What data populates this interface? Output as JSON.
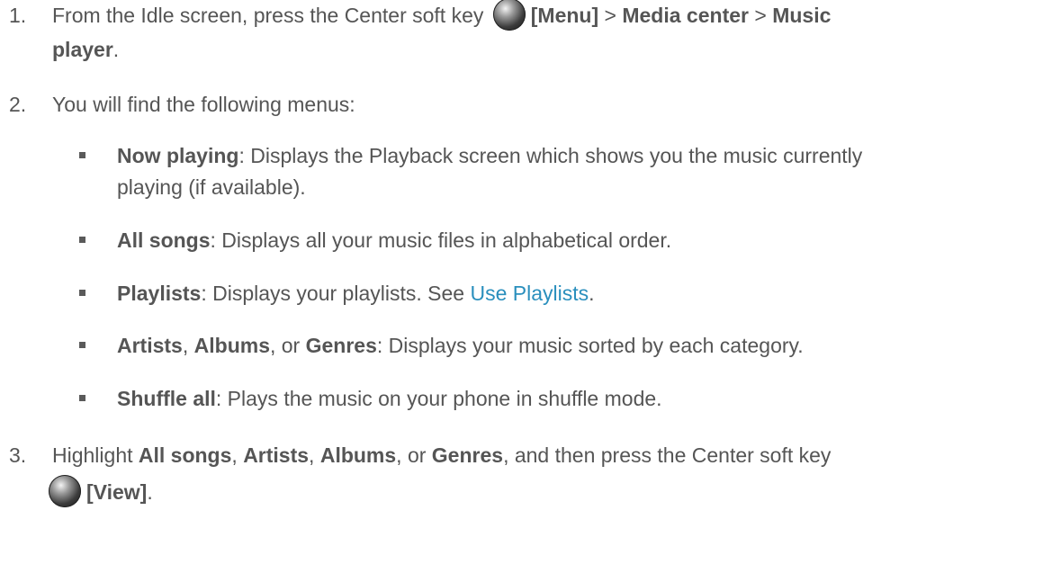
{
  "step1": {
    "number": "1.",
    "prefix": "From the Idle screen, press the Center soft key",
    "key_label": "[Menu]",
    "sep1": ">",
    "media_center": "Media center",
    "sep2": ">",
    "music": "Music",
    "player": "player",
    "end": "."
  },
  "step2": {
    "number": "2.",
    "text": "You will find the following menus:"
  },
  "bullets": {
    "now_playing": {
      "term": "Now playing",
      "desc_line1": ": Displays the Playback screen which shows you the music currently",
      "desc_line2": "playing (if available)."
    },
    "all_songs": {
      "term": "All songs",
      "desc": ": Displays all your music files in alphabetical order."
    },
    "playlists": {
      "term": "Playlists",
      "desc": ": Displays your playlists. See ",
      "link": "Use Playlists",
      "end": "."
    },
    "artists": {
      "term1": "Artists",
      "sep1": ", ",
      "term2": "Albums",
      "sep2": ", or ",
      "term3": "Genres",
      "desc": ": Displays your music sorted by each category."
    },
    "shuffle_all": {
      "term": "Shuffle all",
      "desc": ": Plays the music on your phone in shuffle mode."
    }
  },
  "step3": {
    "number": "3.",
    "t1": "Highlight ",
    "b1": "All songs",
    "t2": ", ",
    "b2": "Artists",
    "t3": ", ",
    "b3": "Albums",
    "t4": ", or ",
    "b4": "Genres",
    "t5": ", and then press the Center soft key",
    "key_label": "[View]",
    "end": "."
  },
  "colors": {
    "text": "#555555",
    "link": "#2a8fbd"
  }
}
